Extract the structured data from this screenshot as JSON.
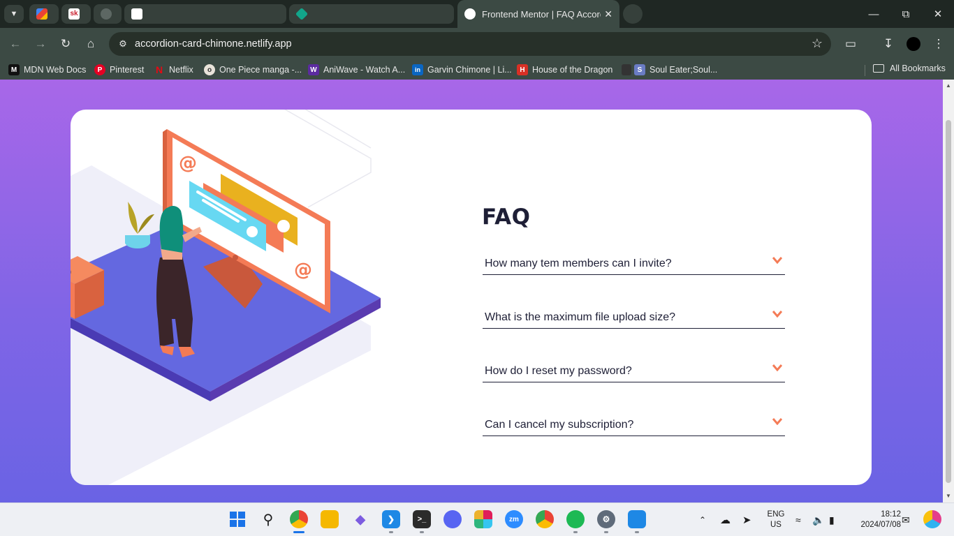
{
  "browser": {
    "tabs": [
      {
        "title": "",
        "favicon": "gmail-icon",
        "color": "#ea4335"
      },
      {
        "title": "",
        "favicon": "sk-icon",
        "color": "#c9202f"
      },
      {
        "title": "",
        "favicon": "github-icon",
        "color": "#2b2b2b"
      },
      {
        "title": "",
        "favicon": "page-icon",
        "color": "#ffffff"
      },
      {
        "title": "",
        "favicon": "diamond-icon",
        "color": "#12a58a"
      },
      {
        "title": "Frontend Mentor | FAQ Accordi",
        "favicon": "frontend-mentor-icon",
        "color": "#ffffff"
      }
    ],
    "url": "accordion-card-chimone.netlify.app",
    "bookmarks": [
      {
        "label": "MDN Web Docs",
        "icon": "M",
        "color": "#111111"
      },
      {
        "label": "Pinterest",
        "icon": "P",
        "color": "#e60023"
      },
      {
        "label": "Netflix",
        "icon": "N",
        "color": "#e50914"
      },
      {
        "label": "One Piece manga -...",
        "icon": "o",
        "color": "#ffffff"
      },
      {
        "label": "AniWave - Watch A...",
        "icon": "W",
        "color": "#5b2ba0"
      },
      {
        "label": "Garvin Chimone | Li...",
        "icon": "in",
        "color": "#0a66c2"
      },
      {
        "label": "House of the Dragon",
        "icon": "H",
        "color": "#d93025"
      },
      {
        "label": "Soul Eater;Soul...",
        "icon": "S",
        "color": "#6a7cc4"
      }
    ],
    "all_bookmarks_label": "All Bookmarks"
  },
  "page": {
    "faq_title": "FAQ",
    "questions": [
      "How many tem members can I invite?",
      "What is the maximum file upload size?",
      "How do I reset my password?",
      "Can I cancel my subscription?"
    ],
    "accent_color": "#f47b56",
    "text_color": "#1e1f36"
  },
  "taskbar": {
    "language": "ENG",
    "region": "US",
    "time": "18:12",
    "date": "2024/07/08"
  }
}
